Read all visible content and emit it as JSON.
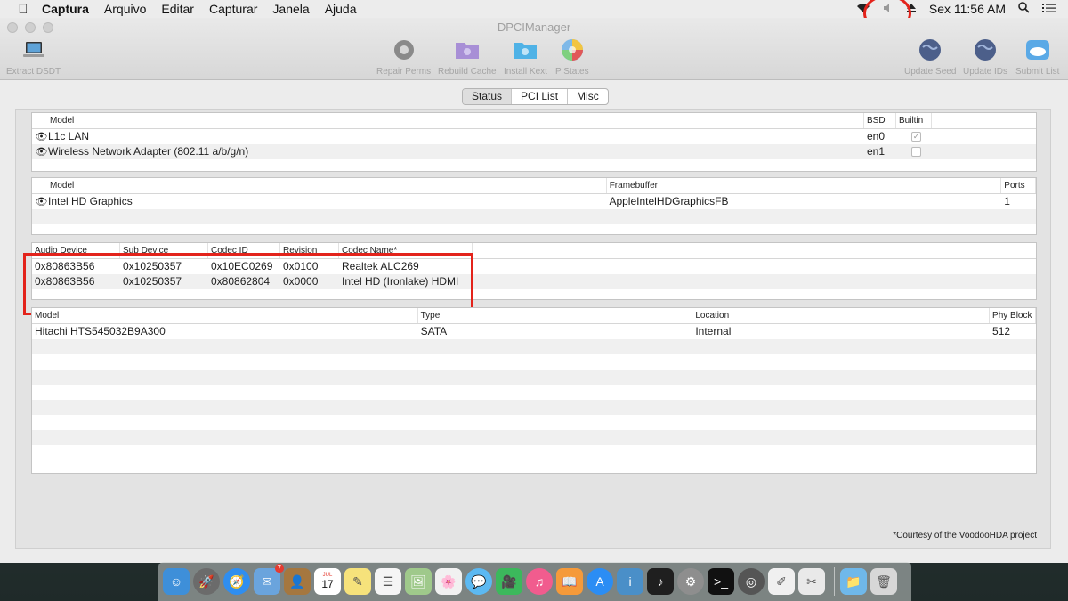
{
  "menubar": {
    "items": [
      "Captura",
      "Arquivo",
      "Editar",
      "Capturar",
      "Janela",
      "Ajuda"
    ],
    "clock": "Sex 11:56 AM"
  },
  "window": {
    "title": "DPCIManager"
  },
  "toolbar": {
    "extract": "Extract DSDT",
    "repair": "Repair Perms",
    "rebuild": "Rebuild Cache",
    "install": "Install Kext",
    "pstates": "P States",
    "update_seed": "Update Seed",
    "update_ids": "Update IDs",
    "submit": "Submit List"
  },
  "tabs": [
    "Status",
    "PCI List",
    "Misc"
  ],
  "network": {
    "headers": [
      "Model",
      "BSD",
      "Builtin"
    ],
    "rows": [
      {
        "model": "L1c LAN",
        "bsd": "en0",
        "builtin": true
      },
      {
        "model": "Wireless Network Adapter (802.11 a/b/g/n)",
        "bsd": "en1",
        "builtin": false
      }
    ]
  },
  "graphics": {
    "headers": [
      "Model",
      "Framebuffer",
      "Ports"
    ],
    "rows": [
      {
        "model": "Intel HD Graphics",
        "framebuffer": "AppleIntelHDGraphicsFB",
        "ports": "1"
      }
    ]
  },
  "audio": {
    "headers": [
      "Audio Device",
      "Sub Device",
      "Codec ID",
      "Revision",
      "Codec Name*"
    ],
    "rows": [
      [
        "0x80863B56",
        "0x10250357",
        "0x10EC0269",
        "0x0100",
        "Realtek ALC269"
      ],
      [
        "0x80863B56",
        "0x10250357",
        "0x80862804",
        "0x0000",
        "Intel HD (Ironlake) HDMI"
      ]
    ]
  },
  "disks": {
    "headers": [
      "Model",
      "Type",
      "Location",
      "Phy Block"
    ],
    "rows": [
      [
        "Hitachi HTS545032B9A300",
        "SATA",
        "Internal",
        "512"
      ]
    ]
  },
  "footnote": "*Courtesy of the VoodooHDA project",
  "dock": {
    "mail_badge": "7",
    "calendar_day": "17",
    "calendar_month": "JUL"
  }
}
